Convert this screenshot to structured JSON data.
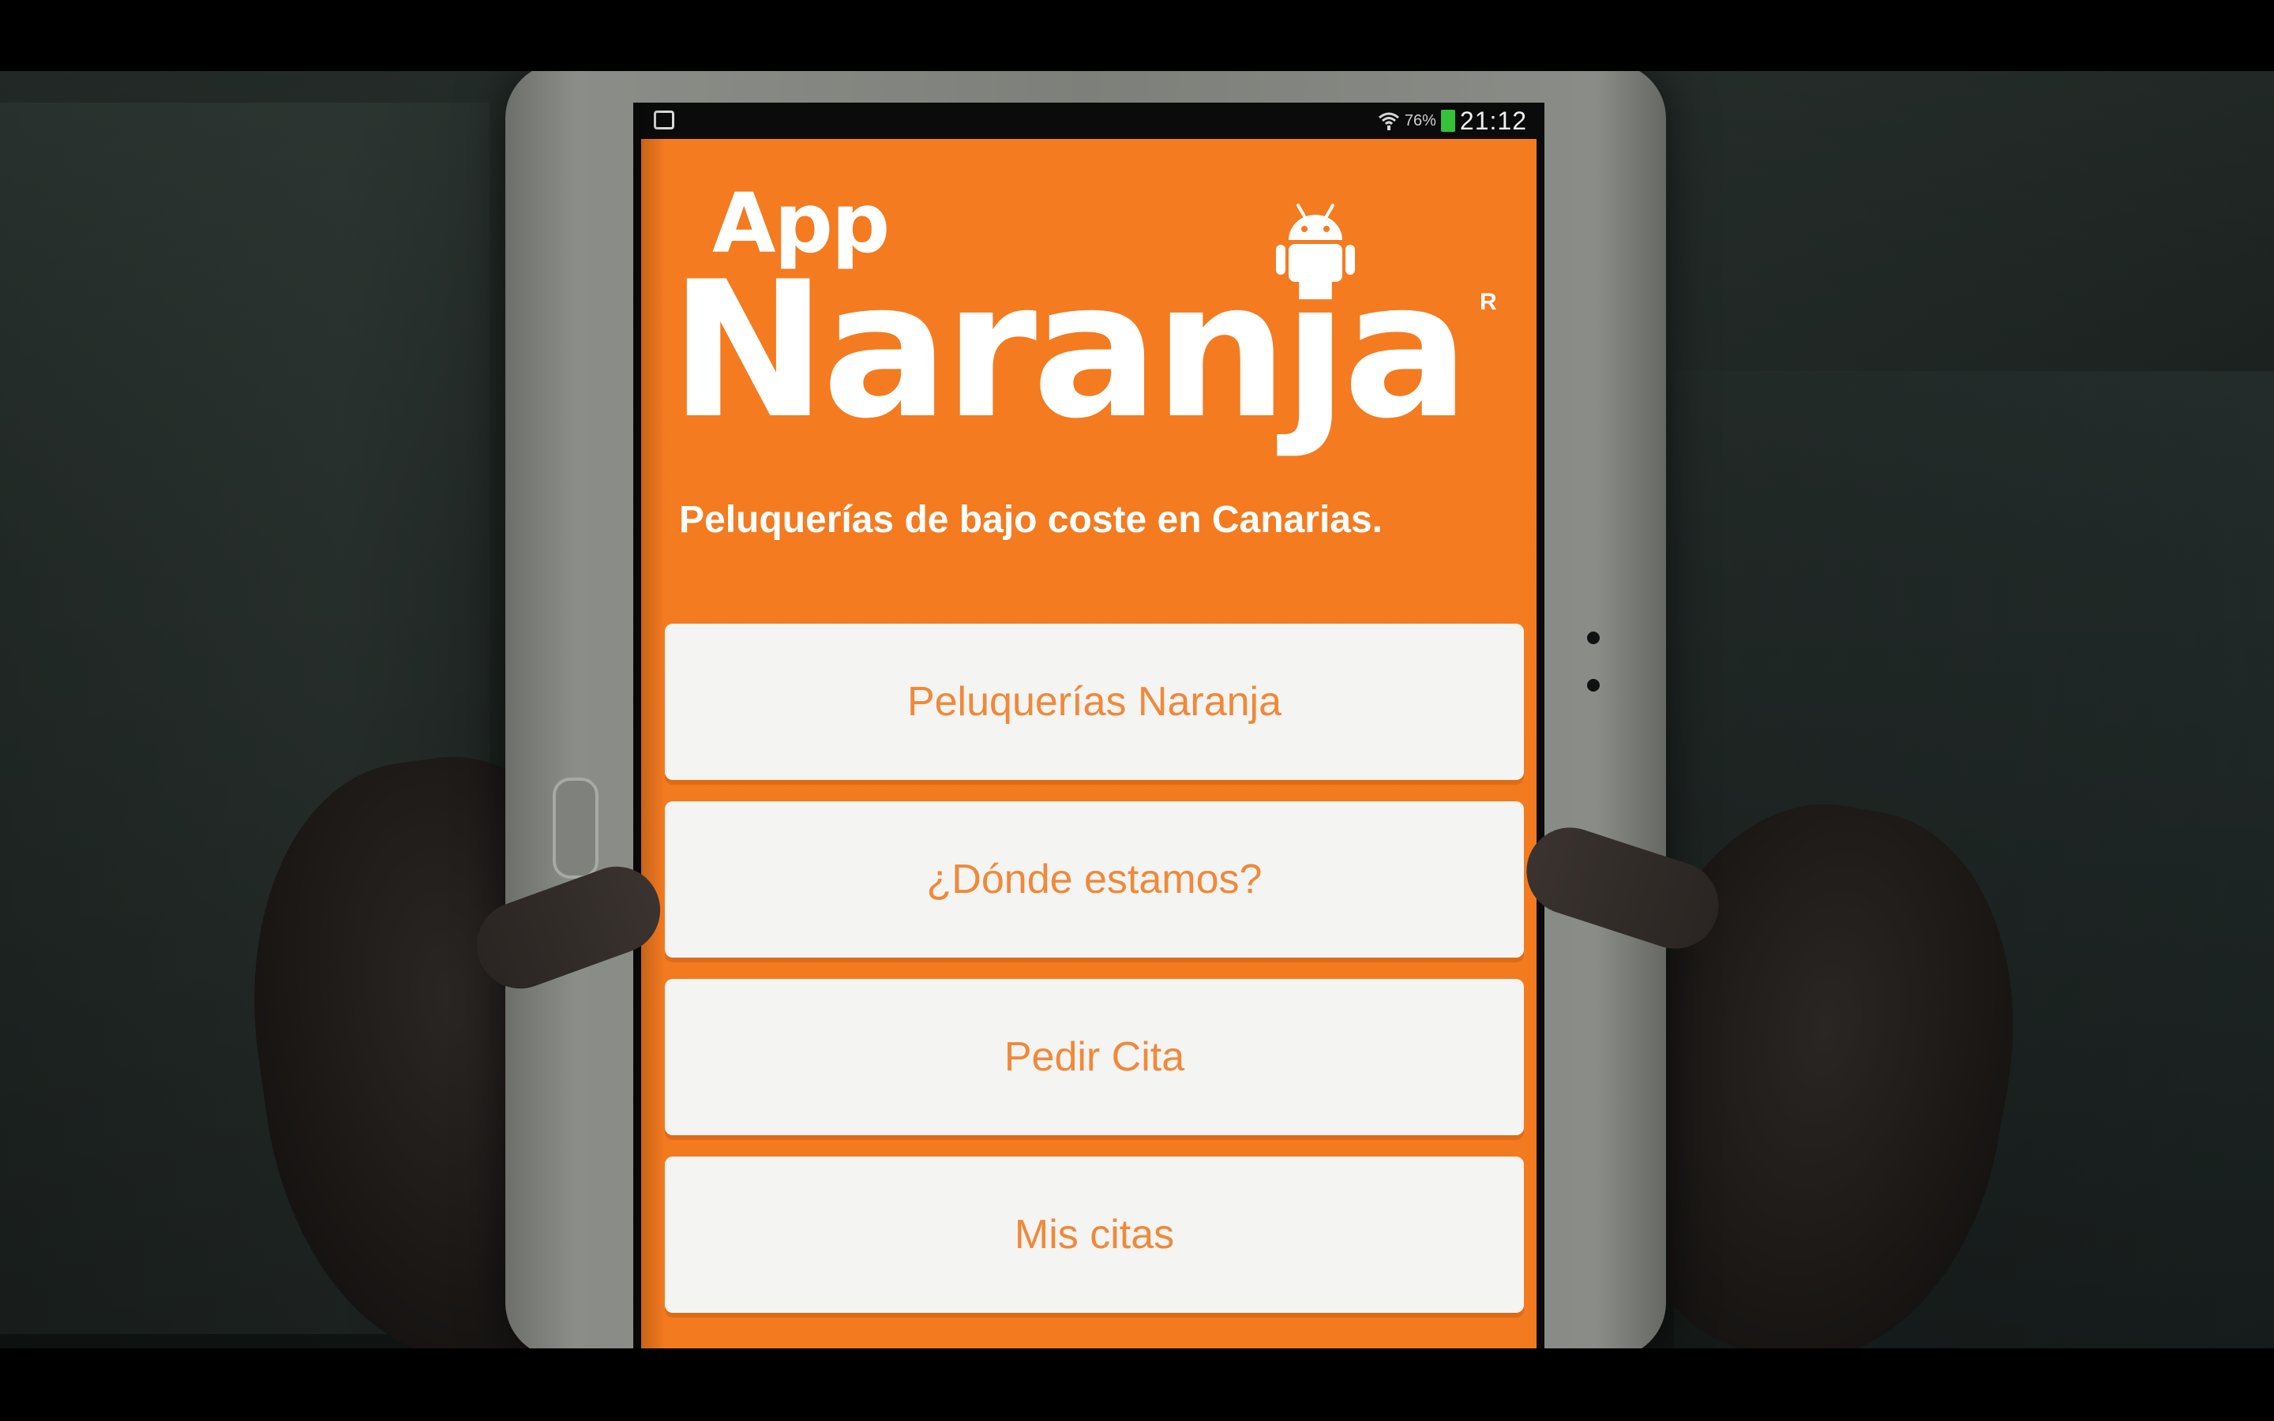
{
  "statusbar": {
    "battery_percent": "76%",
    "time": "21:12",
    "icons": [
      "notification-icon",
      "wifi-icon",
      "battery-icon"
    ],
    "battery_color": "#36c13a"
  },
  "app": {
    "background_color": "#f47b20",
    "logo": {
      "app_text": "App",
      "name_text": "Naranja",
      "registered_mark": "R",
      "icon": "android-icon"
    },
    "tagline": "Peluquerías de bajo coste en Canarias.",
    "menu": [
      {
        "label": "Peluquerías Naranja"
      },
      {
        "label": "¿Dónde estamos?"
      },
      {
        "label": "Pedir Cita"
      },
      {
        "label": "Mis citas"
      }
    ],
    "button_text_color": "#f0893a",
    "button_bg_color": "#f4f4f2"
  }
}
